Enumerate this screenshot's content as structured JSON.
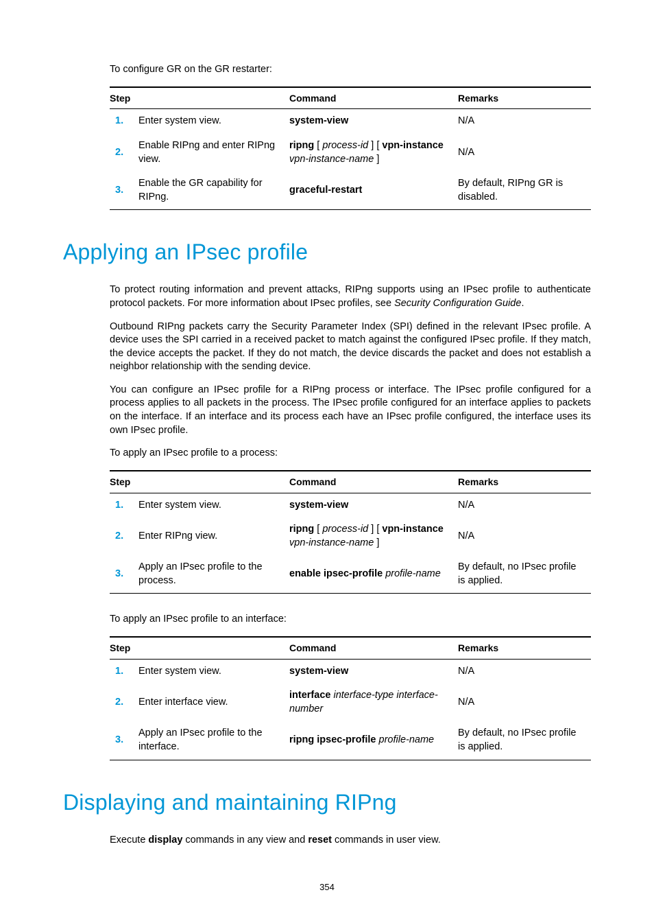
{
  "intro1": "To configure GR on the GR restarter:",
  "headers": {
    "step": "Step",
    "command": "Command",
    "remarks": "Remarks"
  },
  "table1": {
    "rows": [
      {
        "n": "1.",
        "step": "Enter system view.",
        "cmd_b": "system-view",
        "rem": "N/A"
      },
      {
        "n": "2.",
        "step": "Enable RIPng and enter RIPng view.",
        "cmd_b1": "ripng",
        "cmd_i1": "process-id",
        "cmd_b2": "vpn-instance",
        "cmd_i2": "vpn-instance-name",
        "rem": "N/A"
      },
      {
        "n": "3.",
        "step": "Enable the GR capability for RIPng.",
        "cmd_b": "graceful-restart",
        "rem": "By default, RIPng GR is disabled."
      }
    ]
  },
  "h1a": "Applying an IPsec profile",
  "p1": "To protect routing information and prevent attacks, RIPng supports using an IPsec profile to authenticate protocol packets. For more information about IPsec profiles, see ",
  "p1i": "Security Configuration Guide",
  "p1end": ".",
  "p2": "Outbound RIPng packets carry the Security Parameter Index (SPI) defined in the relevant IPsec profile. A device uses the SPI carried in a received packet to match against the configured IPsec profile. If they match, the device accepts the packet. If they do not match, the device discards the packet and does not establish a neighbor relationship with the sending device.",
  "p3": "You can configure an IPsec profile for a RIPng process or interface. The IPsec profile configured for a process applies to all packets in the process. The IPsec profile configured for an interface applies to packets on the interface. If an interface and its process each have an IPsec profile configured, the interface uses its own IPsec profile.",
  "lead2": "To apply an IPsec profile to a process:",
  "table2": {
    "rows": [
      {
        "n": "1.",
        "step": "Enter system view.",
        "cmd_b": "system-view",
        "rem": "N/A"
      },
      {
        "n": "2.",
        "step": "Enter RIPng view.",
        "cmd_b1": "ripng",
        "cmd_i1": "process-id",
        "cmd_b2": "vpn-instance",
        "cmd_i2": "vpn-instance-name",
        "rem": "N/A"
      },
      {
        "n": "3.",
        "step": "Apply an IPsec profile to the process.",
        "cmd_b": "enable ipsec-profile",
        "cmd_i": "profile-name",
        "rem": "By default, no IPsec profile is applied."
      }
    ]
  },
  "lead3": "To apply an IPsec profile to an interface:",
  "table3": {
    "rows": [
      {
        "n": "1.",
        "step": "Enter system view.",
        "cmd_b": "system-view",
        "rem": "N/A"
      },
      {
        "n": "2.",
        "step": "Enter interface view.",
        "cmd_b": "interface",
        "cmd_i": "interface-type interface-number",
        "rem": "N/A"
      },
      {
        "n": "3.",
        "step": "Apply an IPsec profile to the interface.",
        "cmd_b": "ripng ipsec-profile",
        "cmd_i": "profile-name",
        "rem": "By default, no IPsec profile is applied."
      }
    ]
  },
  "h1b": "Displaying and maintaining RIPng",
  "p4a": "Execute ",
  "p4b": "display",
  "p4c": " commands in any view and ",
  "p4d": "reset",
  "p4e": " commands in user view.",
  "pagenum": "354",
  "brackets": {
    "open": " [ ",
    "close": " ]",
    "close_sp": " ] "
  }
}
